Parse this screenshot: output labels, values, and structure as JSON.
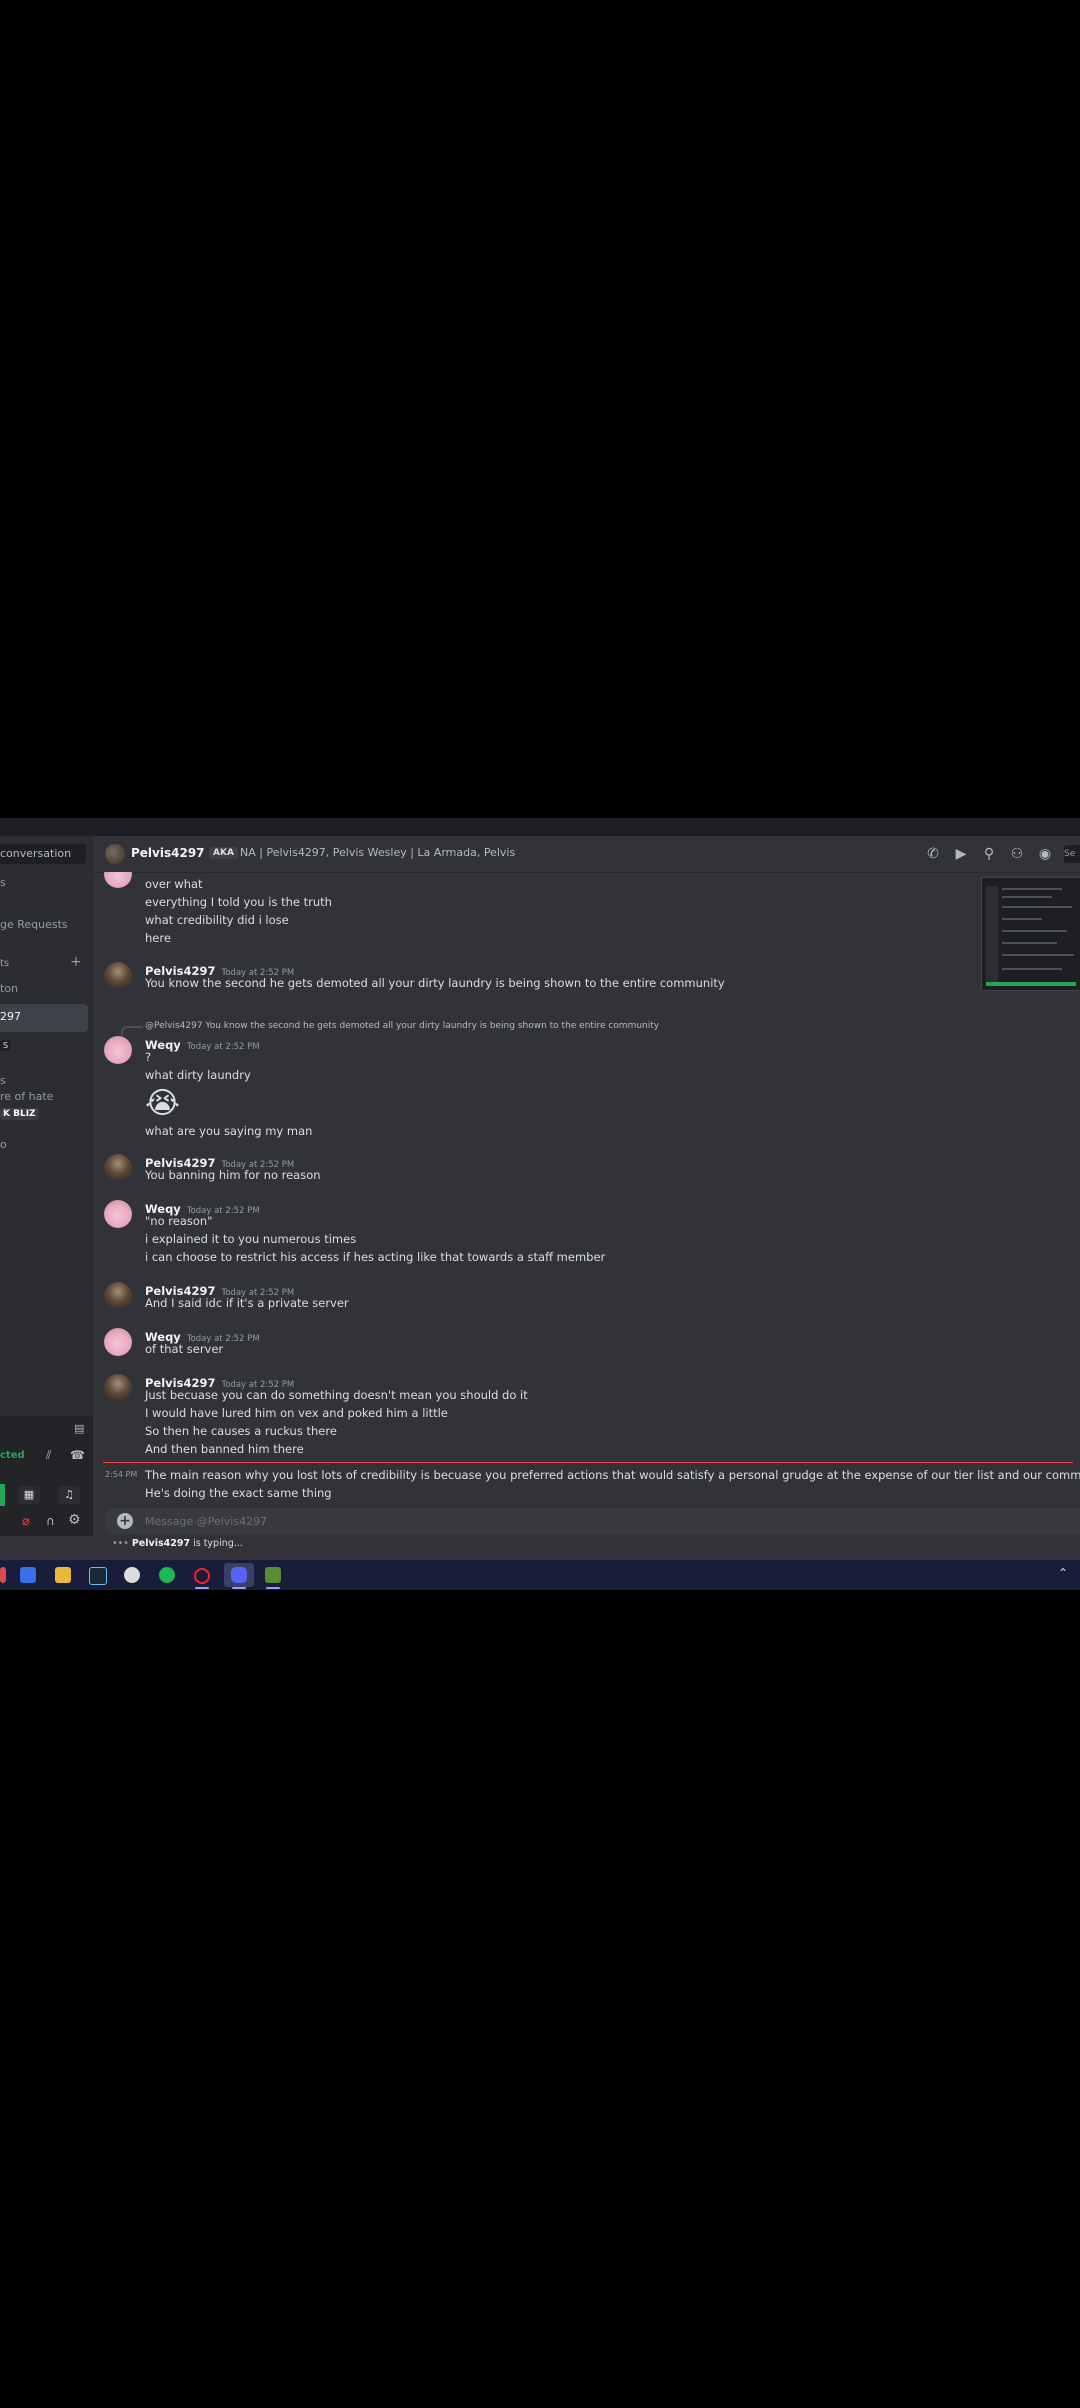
{
  "sidebar": {
    "search_placeholder": "conversation",
    "items": [
      "s",
      "ge Requests",
      "ts",
      "ton",
      "297",
      "S",
      "s",
      "re of hate",
      "o"
    ],
    "badge": "K BLIZ",
    "voice_status": "cted"
  },
  "header": {
    "username": "Pelvis4297",
    "aka_label": "AKA",
    "aka_names": "NA | Pelvis4297, Pelvis Wesley | La Armada, Pelvis",
    "search_label": "Se",
    "icons": [
      "phone-icon",
      "video-icon",
      "pin-icon",
      "add-friend-icon",
      "profile-icon"
    ]
  },
  "messages": {
    "continued_lines": [
      "over what",
      "everything I told you is the truth",
      "what credibility did i lose",
      "here"
    ],
    "groups": [
      {
        "author": "Pelvis4297",
        "time": "Today at 2:52 PM",
        "lines": [
          "You know the second he gets demoted all your dirty laundry is being shown to the entire community"
        ]
      },
      {
        "author": "Weqy",
        "time": "Today at 2:52 PM",
        "reply_to": "@Pelvis4297 You know the second he gets demoted all your dirty laundry is being shown to the entire community",
        "lines": [
          "?",
          "what dirty laundry"
        ],
        "emoji": "😭",
        "after_emoji": [
          "what are you saying my man"
        ]
      },
      {
        "author": "Pelvis4297",
        "time": "Today at 2:52 PM",
        "lines": [
          "You banning him for no reason"
        ]
      },
      {
        "author": "Weqy",
        "time": "Today at 2:52 PM",
        "lines": [
          "\"no reason\"",
          "i explained it to you numerous times",
          "i can choose to restrict his access if hes acting like that towards a staff member"
        ]
      },
      {
        "author": "Pelvis4297",
        "time": "Today at 2:52 PM",
        "lines": [
          "And I said idc if it's a private server"
        ]
      },
      {
        "author": "Weqy",
        "time": "Today at 2:52 PM",
        "lines": [
          "of that server"
        ]
      },
      {
        "author": "Pelvis4297",
        "time": "Today at 2:52 PM",
        "lines": [
          "Just becuase you can do something doesn't mean you should do it",
          "I would have lured him on vex and poked him a little",
          "So then he causes a ruckus there",
          "And then banned him there"
        ]
      }
    ],
    "new_messages": {
      "time": "2:54 PM",
      "lines": [
        "The main reason why you lost lots of credibility is becuase you preferred actions that would satisfy a personal grudge at the expense of our tier list and our community",
        "He's doing the exact same thing"
      ]
    }
  },
  "composer": {
    "placeholder": "Message @Pelvis4297"
  },
  "typing": {
    "user": "Pelvis4297",
    "text": " is typing..."
  },
  "taskbar": {
    "icons": [
      "calendar-icon",
      "store-icon",
      "folder-icon",
      "steam-icon",
      "app-icon",
      "spotify-icon",
      "opera-icon",
      "discord-icon",
      "minecraft-icon"
    ]
  }
}
